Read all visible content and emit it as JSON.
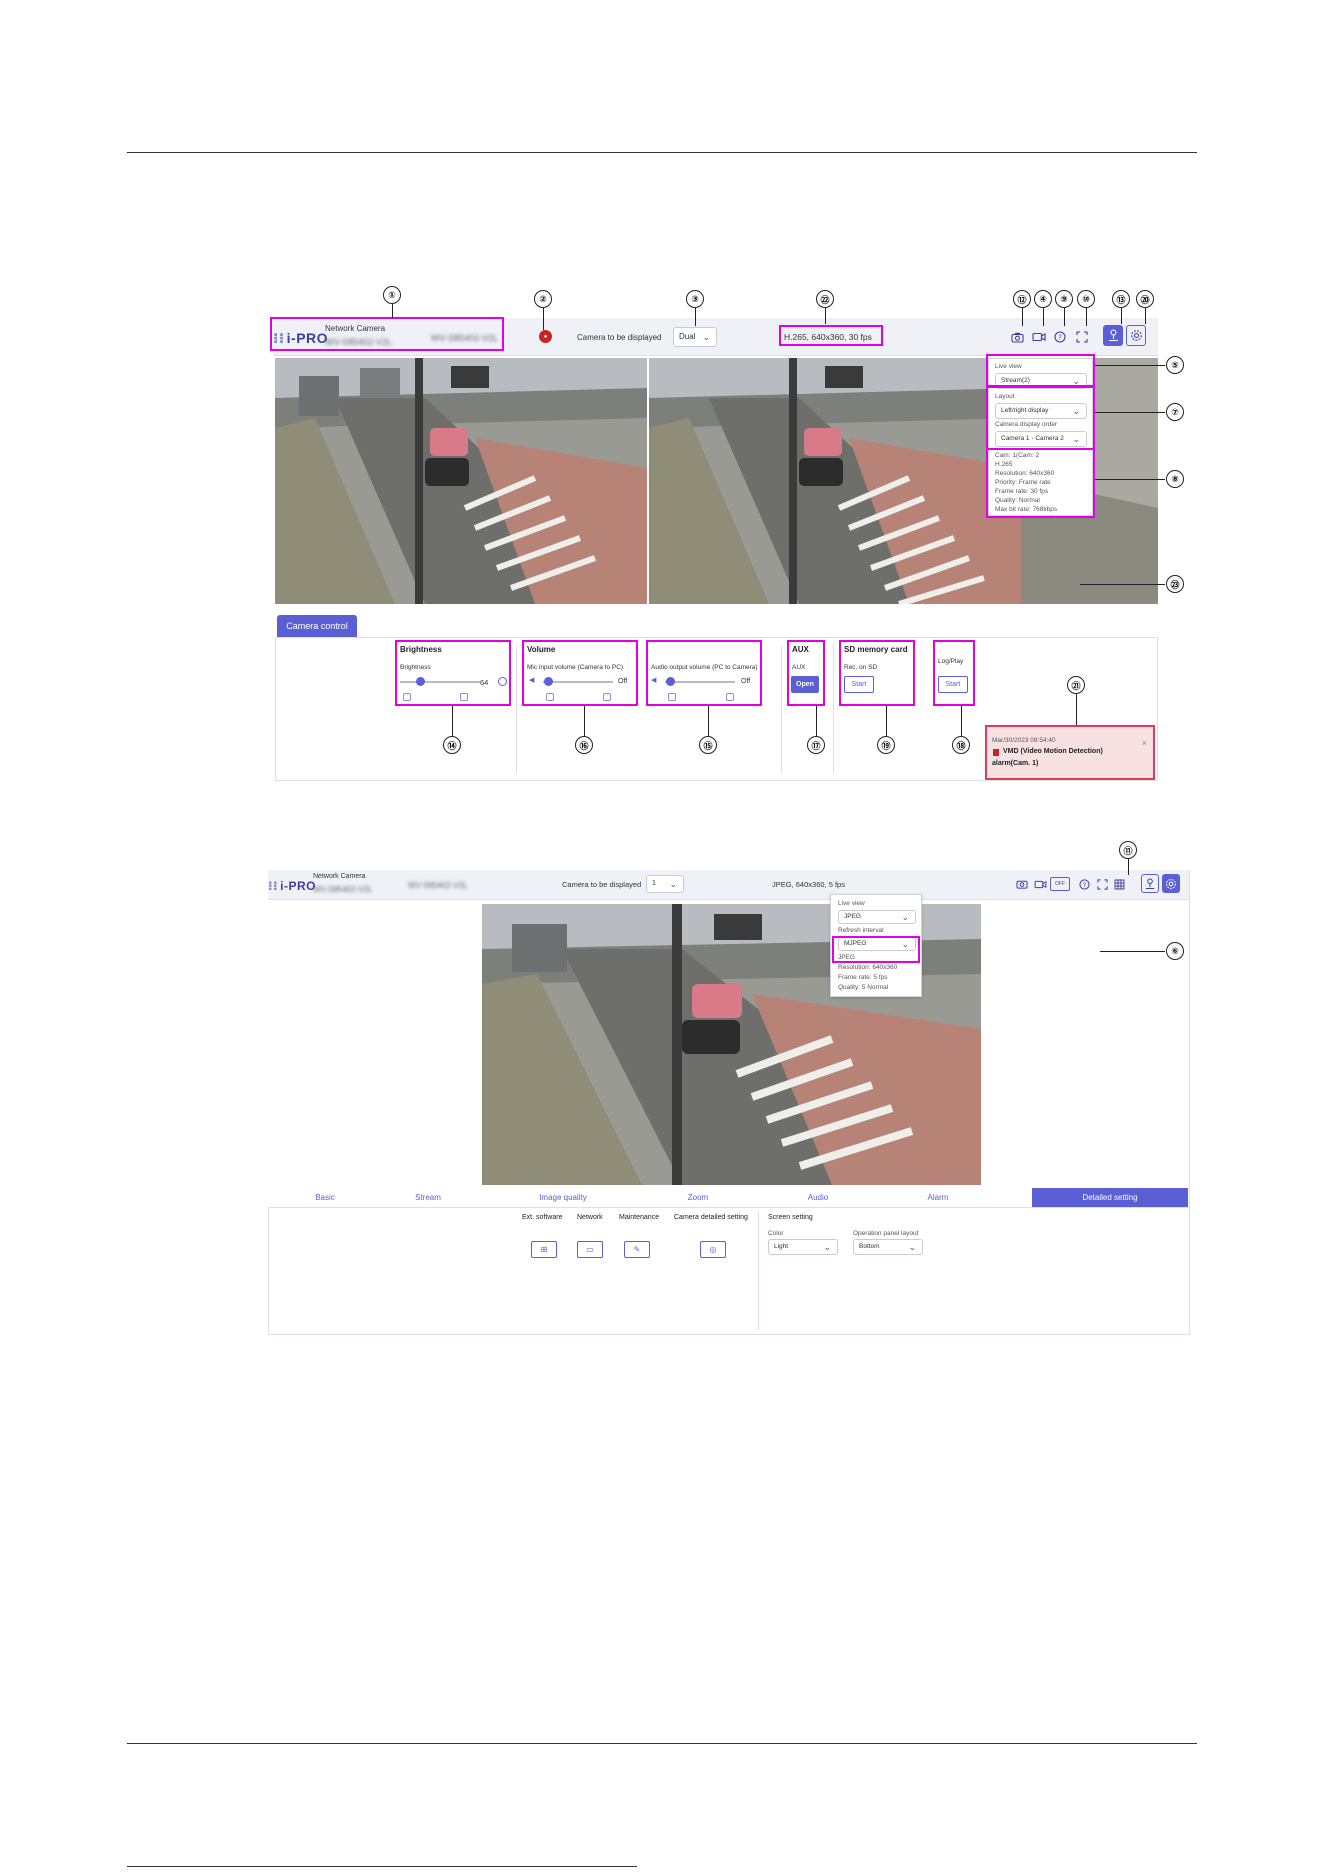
{
  "app": {
    "brand": "i-PRO",
    "product": "Network Camera",
    "model_name": "WV-S85402-V2L",
    "model_number": "WV-S85402-V2L"
  },
  "screen1": {
    "camera_display_label": "Camera to be displayed",
    "camera_display_value": "Dual",
    "stream_info": "H.265, 640x360, 30 fps",
    "popup": {
      "live_view_label": "Live view",
      "live_view_value": "Stream(2)",
      "layout_label": "Layout",
      "layout_value": "Left/right display",
      "display_order_label": "Camera display order",
      "display_order_value": "Camera 1 - Camera 2",
      "info_lines": [
        "Cam: 1(Cam: 2",
        "H.265",
        "Resolution: 640x360",
        "Priority: Frame rate",
        "Frame rate: 30 fps",
        "Quality: Normal",
        "Max bit rate: 768kbps"
      ]
    },
    "control_tab": "Camera control",
    "brightness": {
      "title": "Brightness",
      "label": "Brightness",
      "value": "64"
    },
    "volume": {
      "title": "Volume",
      "mic_label": "Mic input volume (Camera to PC)",
      "mic_value": "Off",
      "audio_label": "Audio output volume (PC to Camera)",
      "audio_value": "Off"
    },
    "aux": {
      "title": "AUX",
      "label": "AUX",
      "button": "Open"
    },
    "sd": {
      "title": "SD memory card",
      "label": "Rec. on SD",
      "button": "Start"
    },
    "log": {
      "label": "Log/Play",
      "button": "Start"
    },
    "alarm": {
      "time": "Mar/30/2023 09:54:40",
      "text": "VMD (Video Motion Detection)",
      "cam": "alarm(Cam. 1)",
      "close": "×"
    }
  },
  "screen2": {
    "camera_display_label": "Camera to be displayed",
    "camera_display_value": "1",
    "stream_info": "JPEG, 640x360, 5 fps",
    "popup": {
      "live_view_label": "Live view",
      "live_view_value": "JPEG",
      "refresh_label": "Refresh interval",
      "refresh_value": "MJPEG",
      "info_lines": [
        "JPEG",
        "Resolution: 640x360",
        "Frame rate: 5 fps",
        "Quality: 5 Normal"
      ]
    },
    "tabs": [
      "Basic",
      "Stream",
      "Image quality",
      "Zoom",
      "Audio",
      "Alarm",
      "Detailed setting"
    ],
    "detail_buttons": [
      "Ext. software",
      "Network",
      "Maintenance",
      "Camera detailed setting"
    ],
    "screen_setting": {
      "title": "Screen setting",
      "color_label": "Color",
      "color_value": "Light",
      "panel_label": "Operation panel layout",
      "panel_value": "Bottom"
    }
  },
  "callouts": {
    "n1": "①",
    "n2": "②",
    "n3": "③",
    "n4": "④",
    "n5": "⑤",
    "n6": "⑥",
    "n7": "⑦",
    "n8": "⑧",
    "n9": "⑨",
    "n10": "⑩",
    "n11": "⑪",
    "n12": "⑫",
    "n13": "⑬",
    "n14": "⑭",
    "n15": "⑮",
    "n16": "⑯",
    "n17": "⑰",
    "n18": "⑱",
    "n19": "⑲",
    "n20": "⑳",
    "n21": "㉑",
    "n22": "㉒",
    "n23": "㉓"
  },
  "icons": {
    "snapshot": "camera-icon",
    "record": "video-icon",
    "help": "help-icon",
    "fullscreen": "fullscreen-icon",
    "zoom_view": "zoom-icon",
    "settings": "gear-icon",
    "grid": "grid-icon",
    "rec_dot": "record-dot-icon"
  },
  "colors": {
    "accent": "#5a5fd6",
    "highlight": "#e400e4",
    "alarm_border": "#e03a5a",
    "rec": "#cc2222"
  }
}
